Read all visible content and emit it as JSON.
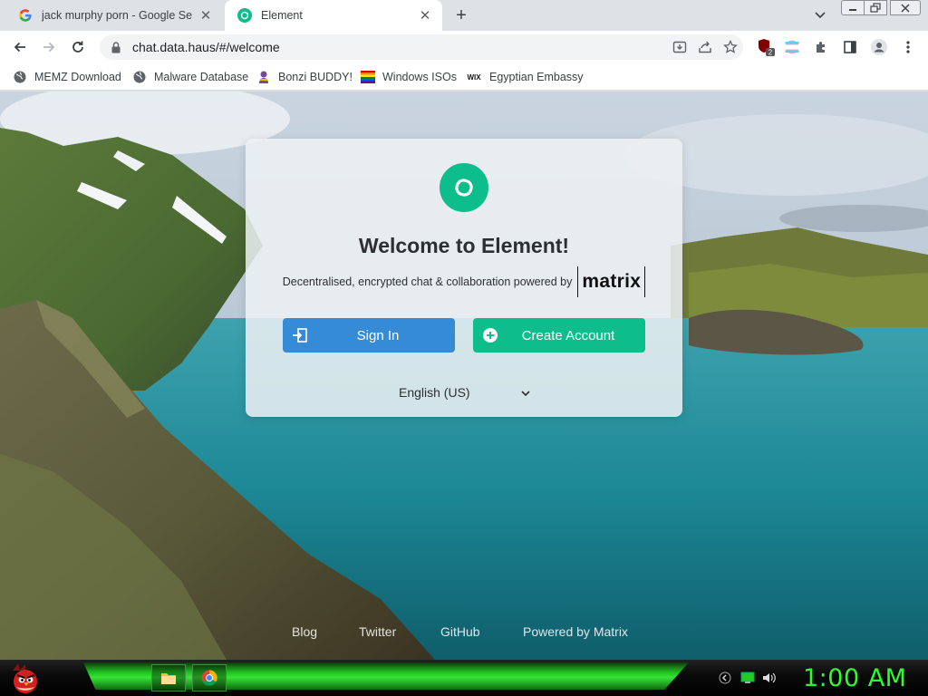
{
  "browser": {
    "tabs": [
      {
        "title": "jack murphy porn - Google Search",
        "favicon": "google-g-icon",
        "active": false
      },
      {
        "title": "Element",
        "favicon": "element-icon",
        "active": true
      }
    ],
    "address": {
      "url": "chat.data.haus/#/welcome"
    },
    "extension_badge": "2",
    "bookmarks": [
      {
        "label": "MEMZ Download",
        "icon": "globe-icon"
      },
      {
        "label": "Malware Database",
        "icon": "globe-icon"
      },
      {
        "label": "Bonzi BUDDY!",
        "icon": "bonzi-icon"
      },
      {
        "label": "Windows ISOs",
        "icon": "rainbow-flag-icon"
      },
      {
        "label": "Egyptian Embassy",
        "icon": "wix-icon"
      }
    ]
  },
  "page": {
    "welcome_title": "Welcome to Element!",
    "tagline": "Decentralised, encrypted chat & collaboration powered by",
    "matrix_logo": "matrix",
    "sign_in_label": "Sign In",
    "create_account_label": "Create Account",
    "language": "English (US)",
    "footer_links": [
      "Blog",
      "Twitter",
      "GitHub",
      "Powered by Matrix"
    ]
  },
  "taskbar": {
    "clock": "1:00 AM"
  },
  "colors": {
    "element_green": "#0dbd8b",
    "sign_in_blue": "#368bd6",
    "clock_green": "#2aff2a"
  }
}
